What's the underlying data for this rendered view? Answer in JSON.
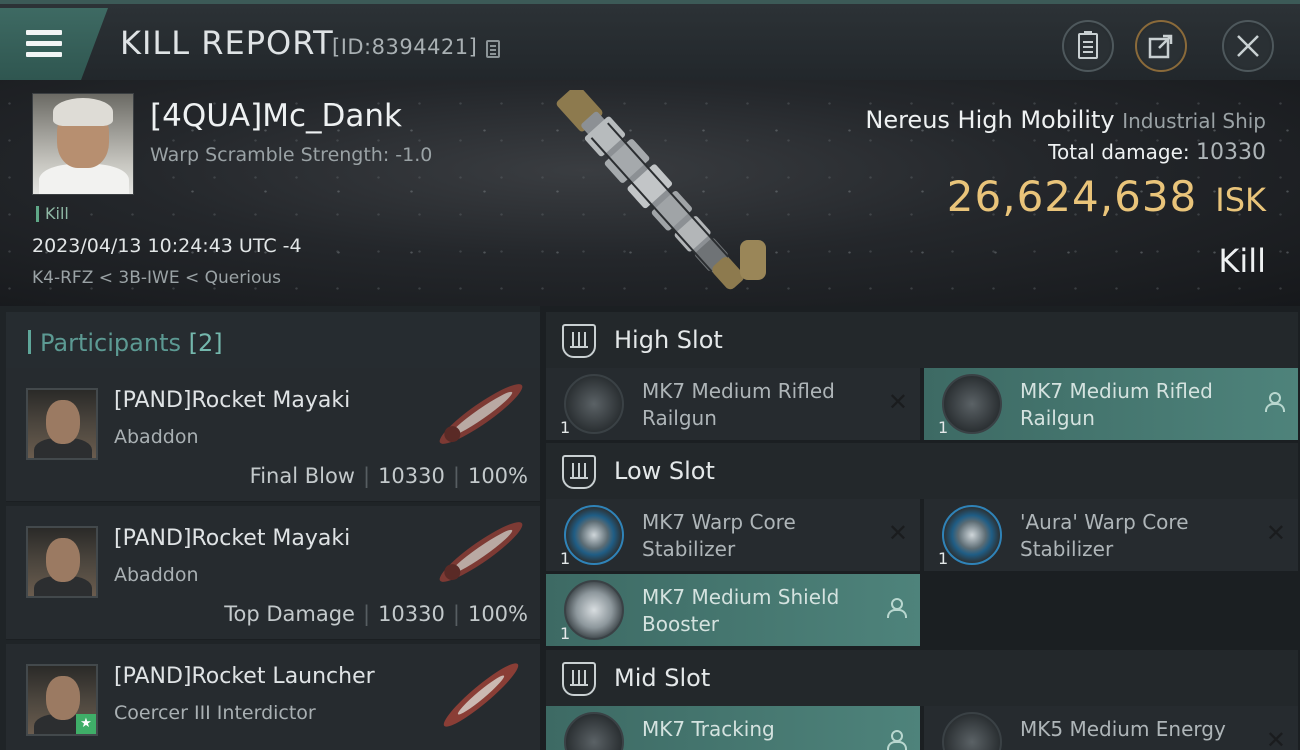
{
  "header": {
    "title": "KILL REPORT",
    "report_id": "[ID:8394421]",
    "icons": [
      "menu-icon",
      "copy-icon",
      "clipboard-icon",
      "share-icon",
      "close-icon"
    ]
  },
  "victim": {
    "pilot_name": "[4QUA]Mc_Dank",
    "warp_scramble": "Warp Scramble Strength: -1.0",
    "kill_tag": "Kill",
    "datetime": "2023/04/13 10:24:43 UTC -4",
    "location": "K4-RFZ < 3B-IWE < Querious",
    "ship_name": "Nereus High Mobility",
    "ship_class": "Industrial Ship",
    "total_damage_label": "Total damage:",
    "total_damage": "10330",
    "isk_value": "26,624,638",
    "isk_unit": "ISK",
    "result": "Kill"
  },
  "participants": {
    "label": "Participants",
    "count": "[2]",
    "items": [
      {
        "name": "[PAND]Rocket Mayaki",
        "ship": "Abaddon",
        "role": "Final Blow",
        "damage": "10330",
        "percent": "100%"
      },
      {
        "name": "[PAND]Rocket Mayaki",
        "ship": "Abaddon",
        "role": "Top Damage",
        "damage": "10330",
        "percent": "100%"
      },
      {
        "name": "[PAND]Rocket Launcher",
        "ship": "Coercer III Interdictor"
      }
    ]
  },
  "fitting": {
    "high_slot": {
      "label": "High Slot",
      "modules": [
        {
          "name": "MK7 Medium Rifled Railgun",
          "qty": "1",
          "status": "destroyed"
        },
        {
          "name": "MK7 Medium Rifled Railgun",
          "qty": "1",
          "status": "dropped"
        }
      ]
    },
    "low_slot": {
      "label": "Low Slot",
      "modules": [
        {
          "name": "MK7 Warp Core Stabilizer",
          "qty": "1",
          "status": "destroyed"
        },
        {
          "name": "'Aura' Warp Core Stabilizer",
          "qty": "1",
          "status": "destroyed"
        },
        {
          "name": "MK7 Medium Shield Booster",
          "qty": "1",
          "status": "dropped"
        }
      ]
    },
    "mid_slot": {
      "label": "Mid Slot",
      "modules": [
        {
          "name": "MK7 Tracking",
          "status": "dropped"
        },
        {
          "name": "MK5 Medium Energy",
          "status": "destroyed"
        }
      ]
    }
  },
  "colors": {
    "accent_teal": "#4e837b",
    "isk_gold": "#e9c47a",
    "participants_label": "#5c9a93",
    "badge_green": "#3fae68"
  }
}
